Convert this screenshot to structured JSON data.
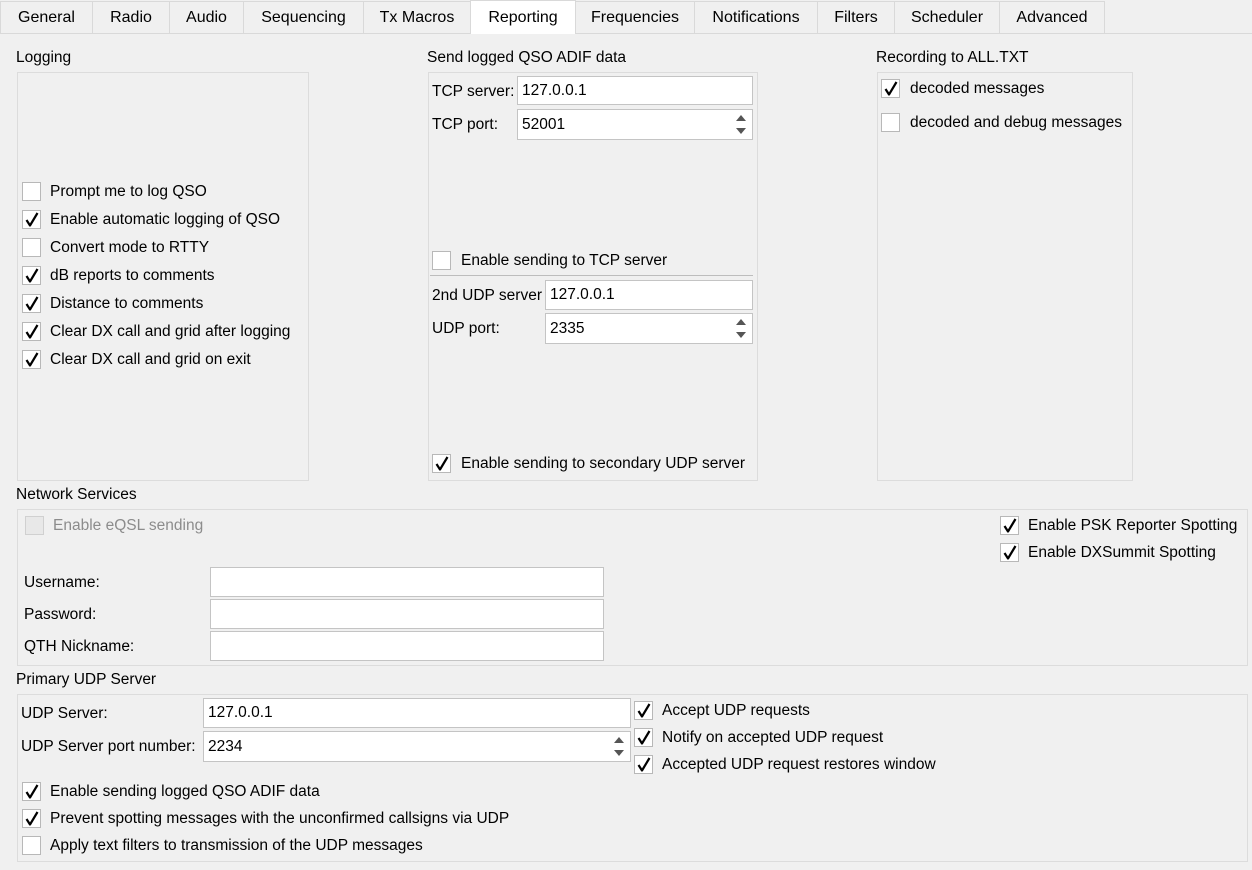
{
  "tabs": [
    "General",
    "Radio",
    "Audio",
    "Sequencing",
    "Tx Macros",
    "Reporting",
    "Frequencies",
    "Notifications",
    "Filters",
    "Scheduler",
    "Advanced"
  ],
  "active_tab": "Reporting",
  "logging": {
    "title": "Logging",
    "items": [
      {
        "label": "Prompt me to log QSO",
        "checked": false
      },
      {
        "label": "Enable automatic logging of QSO",
        "checked": true
      },
      {
        "label": "Convert mode to RTTY",
        "checked": false
      },
      {
        "label": "dB reports to comments",
        "checked": true
      },
      {
        "label": "Distance to comments",
        "checked": true
      },
      {
        "label": "Clear DX call and grid after logging",
        "checked": true
      },
      {
        "label": "Clear DX call and grid on exit",
        "checked": true
      }
    ]
  },
  "adif": {
    "title": "Send logged QSO ADIF data",
    "tcp_server_label": "TCP server:",
    "tcp_server_value": "127.0.0.1",
    "tcp_port_label": "TCP port:",
    "tcp_port_value": "52001",
    "enable_tcp_label": "Enable sending to TCP server",
    "enable_tcp_checked": false,
    "udp2_server_label": "2nd UDP server",
    "udp2_server_value": "127.0.0.1",
    "udp_port_label": "UDP port:",
    "udp_port_value": "2335",
    "enable_udp2_label": "Enable sending to secondary UDP server",
    "enable_udp2_checked": true
  },
  "recording": {
    "title": "Recording to ALL.TXT",
    "items": [
      {
        "label": "decoded messages",
        "checked": true
      },
      {
        "label": "decoded and debug messages",
        "checked": false
      }
    ]
  },
  "network": {
    "title": "Network Services",
    "eqsl_label": "Enable eQSL sending",
    "eqsl_checked": false,
    "psk_label": "Enable PSK Reporter Spotting",
    "psk_checked": true,
    "dxsummit_label": "Enable DXSummit Spotting",
    "dxsummit_checked": true,
    "username_label": "Username:",
    "username_value": "",
    "password_label": "Password:",
    "password_value": "",
    "qth_label": "QTH Nickname:",
    "qth_value": ""
  },
  "udp": {
    "title": "Primary UDP Server",
    "server_label": "UDP Server:",
    "server_value": "127.0.0.1",
    "port_label": "UDP Server port number:",
    "port_value": "2234",
    "accept_label": "Accept UDP requests",
    "accept_checked": true,
    "notify_label": "Notify on accepted UDP request",
    "notify_checked": true,
    "restore_label": "Accepted UDP request restores window",
    "restore_checked": true,
    "adif_label": "Enable sending logged QSO ADIF data",
    "adif_checked": true,
    "prevent_label": "Prevent spotting messages with the unconfirmed callsigns via UDP",
    "prevent_checked": true,
    "filters_label": "Apply text filters to transmission of the UDP messages",
    "filters_checked": false
  },
  "icons": {
    "check": "checkmark-icon",
    "spin_up": "spin-up-arrow-icon",
    "spin_down": "spin-down-arrow-icon"
  }
}
